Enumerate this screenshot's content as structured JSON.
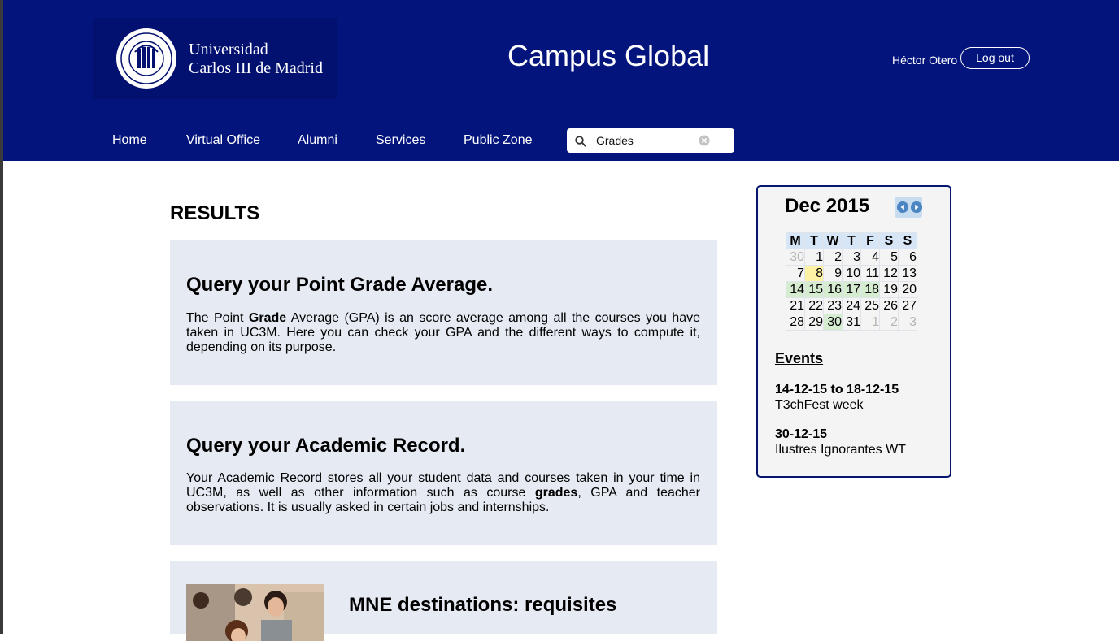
{
  "header": {
    "logo_line1": "Universidad",
    "logo_line2": "Carlos III de Madrid",
    "app_title": "Campus Global",
    "user_name": "Héctor Otero",
    "logout_label": "Log out"
  },
  "nav": {
    "items": [
      {
        "label": "Home"
      },
      {
        "label": "Virtual Office"
      },
      {
        "label": "Alumni"
      },
      {
        "label": "Services"
      },
      {
        "label": "Public Zone"
      }
    ]
  },
  "search": {
    "value": "Grades"
  },
  "main": {
    "title": "RESULTS",
    "results": [
      {
        "title": "Query your Point Grade Average.",
        "desc_pre": "The Point ",
        "desc_bold": "Grade",
        "desc_post": " Average (GPA) is an score average among all the courses you have taken in UC3M. Here you can check your GPA and the different ways to compute it, depending on its purpose."
      },
      {
        "title": "Query your Academic Record.",
        "desc_pre": "Your Academic Record stores all your student data and courses taken in your time in UC3M, as well as other information such as course ",
        "desc_bold": "grades",
        "desc_post": ", GPA and teacher observations. It is usually asked in certain jobs and internships."
      },
      {
        "title": "MNE destinations: requisites"
      }
    ]
  },
  "calendar": {
    "month_label": "Dec 2015",
    "weekdays": [
      "M",
      "T",
      "W",
      "T",
      "F",
      "S",
      "S"
    ],
    "weeks": [
      [
        {
          "d": "30",
          "s": "muted"
        },
        {
          "d": "1",
          "s": ""
        },
        {
          "d": "2",
          "s": ""
        },
        {
          "d": "3",
          "s": ""
        },
        {
          "d": "4",
          "s": ""
        },
        {
          "d": "5",
          "s": ""
        },
        {
          "d": "6",
          "s": ""
        }
      ],
      [
        {
          "d": "7",
          "s": ""
        },
        {
          "d": "8",
          "s": "today"
        },
        {
          "d": "9",
          "s": ""
        },
        {
          "d": "10",
          "s": ""
        },
        {
          "d": "11",
          "s": ""
        },
        {
          "d": "12",
          "s": ""
        },
        {
          "d": "13",
          "s": ""
        }
      ],
      [
        {
          "d": "14",
          "s": "event"
        },
        {
          "d": "15",
          "s": "event"
        },
        {
          "d": "16",
          "s": "event"
        },
        {
          "d": "17",
          "s": "event"
        },
        {
          "d": "18",
          "s": "event"
        },
        {
          "d": "19",
          "s": ""
        },
        {
          "d": "20",
          "s": ""
        }
      ],
      [
        {
          "d": "21",
          "s": ""
        },
        {
          "d": "22",
          "s": ""
        },
        {
          "d": "23",
          "s": ""
        },
        {
          "d": "24",
          "s": ""
        },
        {
          "d": "25",
          "s": ""
        },
        {
          "d": "26",
          "s": ""
        },
        {
          "d": "27",
          "s": ""
        }
      ],
      [
        {
          "d": "28",
          "s": ""
        },
        {
          "d": "29",
          "s": ""
        },
        {
          "d": "30",
          "s": "event"
        },
        {
          "d": "31",
          "s": ""
        },
        {
          "d": "1",
          "s": "muted"
        },
        {
          "d": "2",
          "s": "muted"
        },
        {
          "d": "3",
          "s": "muted"
        }
      ]
    ]
  },
  "events": {
    "title": "Events",
    "items": [
      {
        "date": "14-12-15 to 18-12-15",
        "name": "T3chFest week"
      },
      {
        "date": "30-12-15",
        "name": "Ilustres Ignorantes WT"
      }
    ]
  },
  "colors": {
    "header_bg": "#03157c",
    "card_bg": "#e6ebf3",
    "today_highlight": "#fdf1a3",
    "event_highlight": "#d6ecd0"
  }
}
